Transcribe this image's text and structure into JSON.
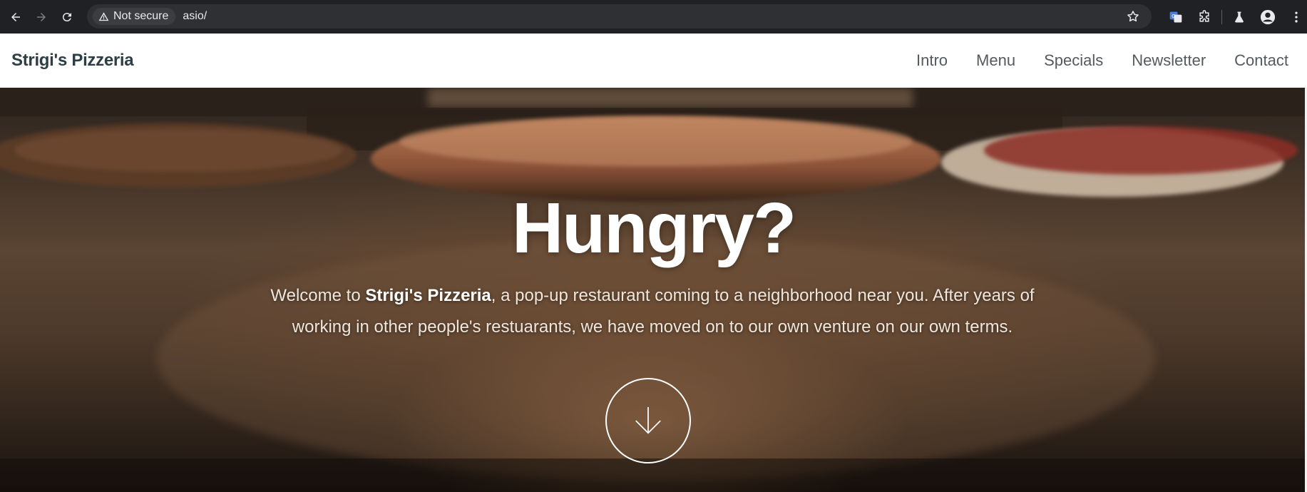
{
  "browser": {
    "security_label": "Not secure",
    "url": "asio/",
    "icons": [
      "back-arrow-icon",
      "forward-arrow-icon",
      "reload-icon",
      "warning-icon",
      "star-icon",
      "translate-icon",
      "extensions-icon",
      "labs-icon",
      "profile-icon",
      "more-icon"
    ]
  },
  "site": {
    "brand": "Strigi's Pizzeria",
    "nav": [
      "Intro",
      "Menu",
      "Specials",
      "Newsletter",
      "Contact"
    ]
  },
  "hero": {
    "title": "Hungry?",
    "intro_prefix": "Welcome to ",
    "intro_brand": "Strigi's Pizzeria",
    "intro_suffix": ", a pop-up restaurant coming to a neighborhood near you. After years of working in other people's restuarants, we have moved on to our own venture on our own terms.",
    "scroll_icon": "arrow-down-icon"
  },
  "colors": {
    "chrome_bg": "#202124",
    "brand_text": "#2d3e45",
    "nav_text": "#555a5f",
    "hero_text": "#ffffff"
  }
}
